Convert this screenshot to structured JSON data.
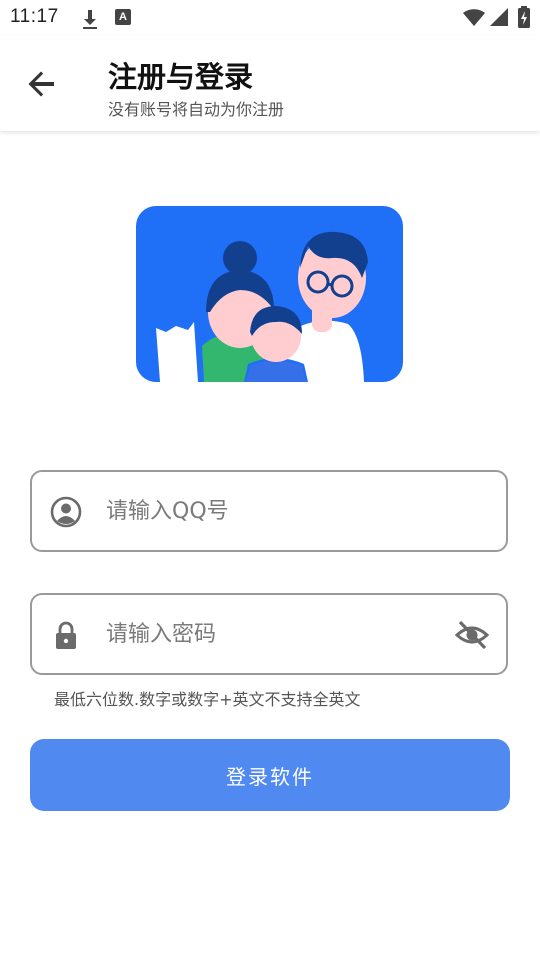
{
  "status_bar": {
    "time": "11:17",
    "icons": [
      "download-icon",
      "a-notification-icon",
      "wifi-icon",
      "signal-icon",
      "battery-charging-icon"
    ]
  },
  "app_bar": {
    "back_icon": "arrow-back-icon",
    "title": "注册与登录",
    "subtitle": "没有账号将自动为你注册"
  },
  "illustration": {
    "name": "family-illustration",
    "background": "#1f6ff7"
  },
  "form": {
    "qq": {
      "placeholder": "请输入QQ号",
      "value": "",
      "icon": "user-circle-icon"
    },
    "password": {
      "placeholder": "请输入密码",
      "value": "",
      "icon": "lock-icon",
      "toggle_icon": "eye-off-icon"
    },
    "hint": "最低六位数.数字或数字+英文不支持全英文",
    "submit_label": "登录软件"
  },
  "colors": {
    "accent": "#5089f0",
    "border": "#9a9a9a",
    "illustration_bg": "#1f6ff7"
  }
}
